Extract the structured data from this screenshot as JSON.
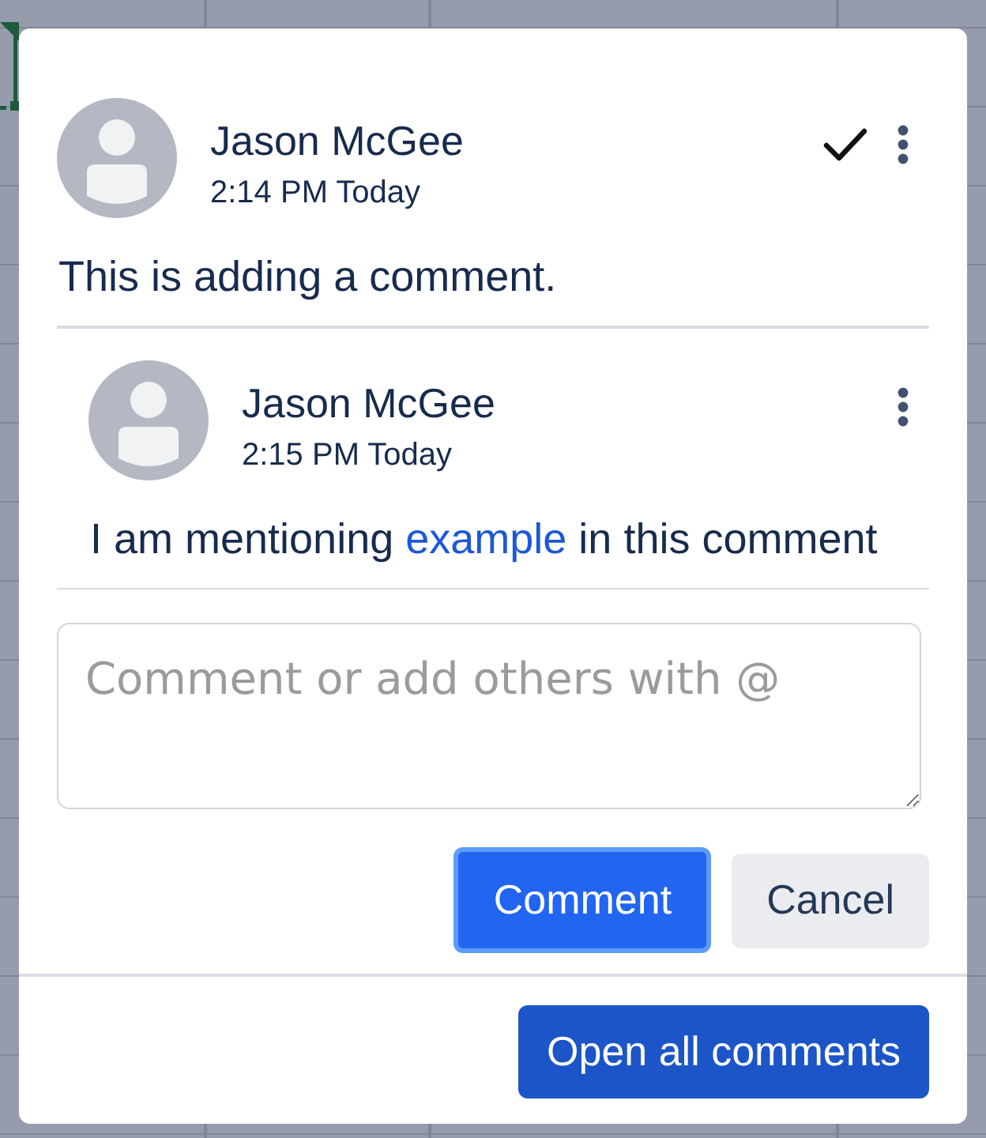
{
  "comments": [
    {
      "kind": "root",
      "author": "Jason McGee",
      "time": "2:14 PM Today",
      "body": [
        {
          "kind": "text",
          "text": "This is adding a comment."
        }
      ]
    },
    {
      "kind": "reply",
      "author": "Jason McGee",
      "time": "2:15 PM Today",
      "body": [
        {
          "kind": "text",
          "text": "I am mentioning "
        },
        {
          "kind": "mention",
          "text": "example"
        },
        {
          "kind": "text",
          "text": " in this comment"
        }
      ]
    }
  ],
  "composer": {
    "placeholder": "Comment or add others with @",
    "buttons": [
      {
        "label": "Comment",
        "kind": "primary",
        "focused": true
      },
      {
        "label": "Cancel",
        "kind": "secondary",
        "focused": false
      }
    ]
  },
  "footer": {
    "button": "Open all comments"
  }
}
